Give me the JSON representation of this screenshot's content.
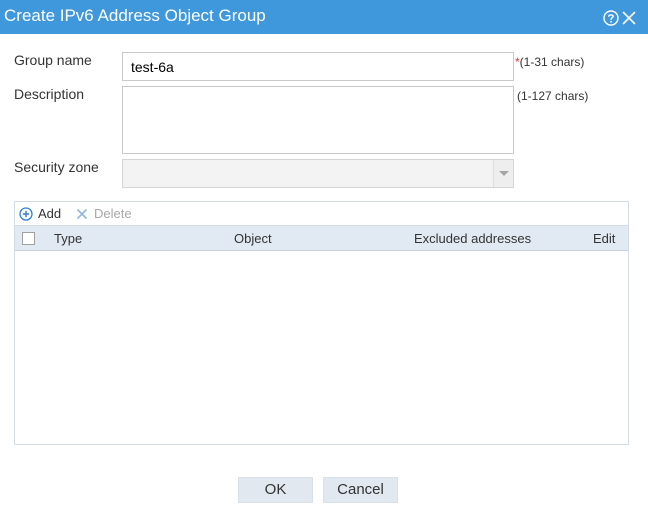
{
  "dialog": {
    "title": "Create IPv6 Address Object Group"
  },
  "form": {
    "group_name": {
      "label": "Group name",
      "value": "test-6a",
      "required_mark": "*",
      "hint": "(1-31 chars)"
    },
    "description": {
      "label": "Description",
      "value": "",
      "hint": "(1-127 chars)"
    },
    "security_zone": {
      "label": "Security zone",
      "value": ""
    }
  },
  "toolbar": {
    "add_label": "Add",
    "delete_label": "Delete"
  },
  "table": {
    "columns": [
      "Type",
      "Object",
      "Excluded addresses",
      "Edit"
    ],
    "rows": []
  },
  "footer": {
    "ok_label": "OK",
    "cancel_label": "Cancel"
  },
  "colors": {
    "title_bar": "#3f97dc",
    "header_row": "#e1e9f2",
    "button": "#e1e8f0",
    "required": "#e0302b"
  },
  "icons": {
    "help": "help-icon",
    "close": "close-icon",
    "add": "plus-circle-icon",
    "delete": "x-icon",
    "dropdown": "chevron-down-icon"
  }
}
